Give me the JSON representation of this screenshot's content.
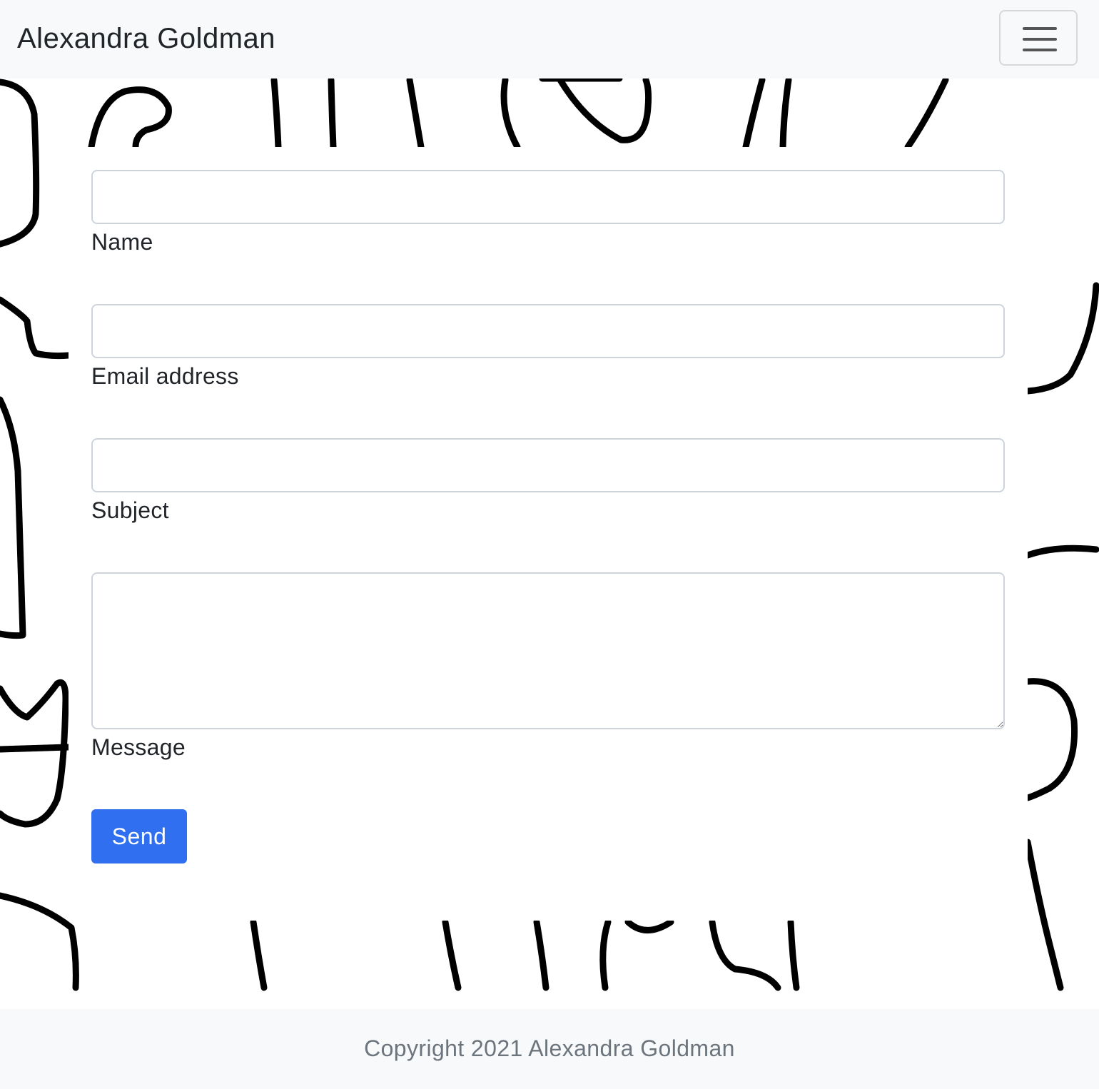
{
  "navbar": {
    "brand": "Alexandra Goldman",
    "toggle_icon": "hamburger-menu-icon"
  },
  "form": {
    "fields": [
      {
        "label": "Name",
        "value": "",
        "placeholder": ""
      },
      {
        "label": "Email address",
        "value": "",
        "placeholder": ""
      },
      {
        "label": "Subject",
        "value": "",
        "placeholder": ""
      },
      {
        "label": "Message",
        "value": "",
        "placeholder": ""
      }
    ],
    "submit_label": "Send"
  },
  "footer": {
    "text": "Copyright 2021 Alexandra Goldman"
  },
  "colors": {
    "navbar_bg": "#f8f9fa",
    "button_primary": "#2f6ff0",
    "footer_text": "#6c757d"
  }
}
